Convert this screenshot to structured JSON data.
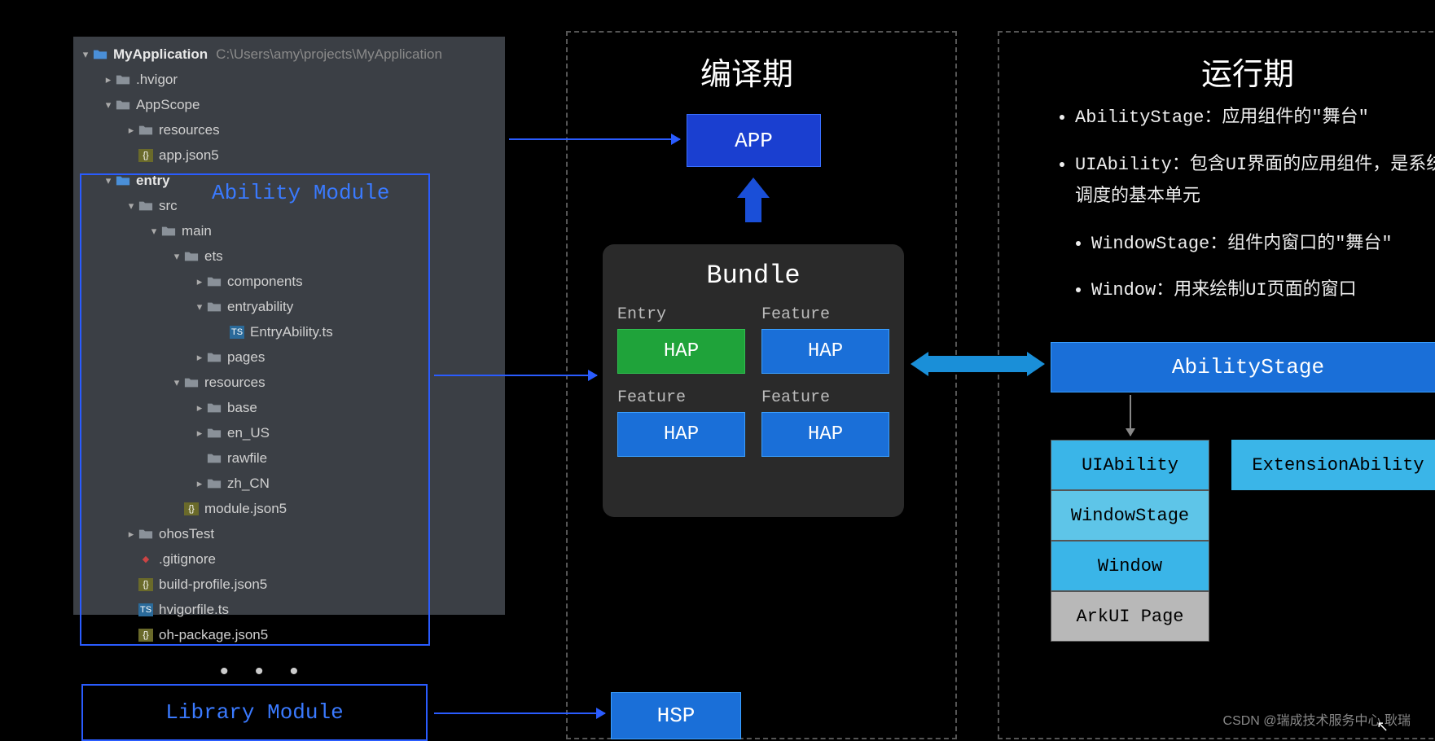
{
  "tree": {
    "root": "MyApplication",
    "root_path": "C:\\Users\\amy\\projects\\MyApplication",
    "items": [
      {
        "name": ".hvigor",
        "indent": 1,
        "chev": "right",
        "type": "folder"
      },
      {
        "name": "AppScope",
        "indent": 1,
        "chev": "down",
        "type": "folder"
      },
      {
        "name": "resources",
        "indent": 2,
        "chev": "right",
        "type": "folder"
      },
      {
        "name": "app.json5",
        "indent": 2,
        "chev": "",
        "type": "json"
      },
      {
        "name": "entry",
        "indent": 1,
        "chev": "down",
        "type": "folder-hl",
        "bold": true
      },
      {
        "name": "src",
        "indent": 2,
        "chev": "down",
        "type": "folder"
      },
      {
        "name": "main",
        "indent": 3,
        "chev": "down",
        "type": "folder"
      },
      {
        "name": "ets",
        "indent": 4,
        "chev": "down",
        "type": "folder"
      },
      {
        "name": "components",
        "indent": 5,
        "chev": "right",
        "type": "folder"
      },
      {
        "name": "entryability",
        "indent": 5,
        "chev": "down",
        "type": "folder"
      },
      {
        "name": "EntryAbility.ts",
        "indent": 6,
        "chev": "",
        "type": "ts"
      },
      {
        "name": "pages",
        "indent": 5,
        "chev": "right",
        "type": "folder"
      },
      {
        "name": "resources",
        "indent": 4,
        "chev": "down",
        "type": "folder"
      },
      {
        "name": "base",
        "indent": 5,
        "chev": "right",
        "type": "folder"
      },
      {
        "name": "en_US",
        "indent": 5,
        "chev": "right",
        "type": "folder"
      },
      {
        "name": "rawfile",
        "indent": 5,
        "chev": "",
        "type": "folder"
      },
      {
        "name": "zh_CN",
        "indent": 5,
        "chev": "right",
        "type": "folder"
      },
      {
        "name": "module.json5",
        "indent": 4,
        "chev": "",
        "type": "json"
      },
      {
        "name": "ohosTest",
        "indent": 2,
        "chev": "right",
        "type": "folder"
      },
      {
        "name": ".gitignore",
        "indent": 2,
        "chev": "",
        "type": "git"
      },
      {
        "name": "build-profile.json5",
        "indent": 2,
        "chev": "",
        "type": "json"
      },
      {
        "name": "hvigorfile.ts",
        "indent": 2,
        "chev": "",
        "type": "ts"
      },
      {
        "name": "oh-package.json5",
        "indent": 2,
        "chev": "",
        "type": "json"
      }
    ]
  },
  "ability_module_label": "Ability Module",
  "library_module_label": "Library Module",
  "compile": {
    "title": "编译期",
    "app": "APP",
    "bundle_title": "Bundle",
    "haps": [
      {
        "label": "Entry",
        "box": "HAP",
        "color": "green"
      },
      {
        "label": "Feature",
        "box": "HAP",
        "color": "blue"
      },
      {
        "label": "Feature",
        "box": "HAP",
        "color": "blue"
      },
      {
        "label": "Feature",
        "box": "HAP",
        "color": "blue"
      }
    ],
    "hsp": "HSP"
  },
  "runtime": {
    "title": "运行期",
    "bullets": [
      "AbilityStage：应用组件的\"舞台\"",
      "UIAbility：包含UI界面的应用组件，是系统调度的基本单元",
      "WindowStage：组件内窗口的\"舞台\"",
      "Window：用来绘制UI页面的窗口"
    ],
    "ability_stage": "AbilityStage",
    "stack": [
      "UIAbility",
      "WindowStage",
      "Window",
      "ArkUI Page"
    ],
    "extension": "ExtensionAbility"
  },
  "watermark": "CSDN @瑞成技术服务中心 耿瑞"
}
